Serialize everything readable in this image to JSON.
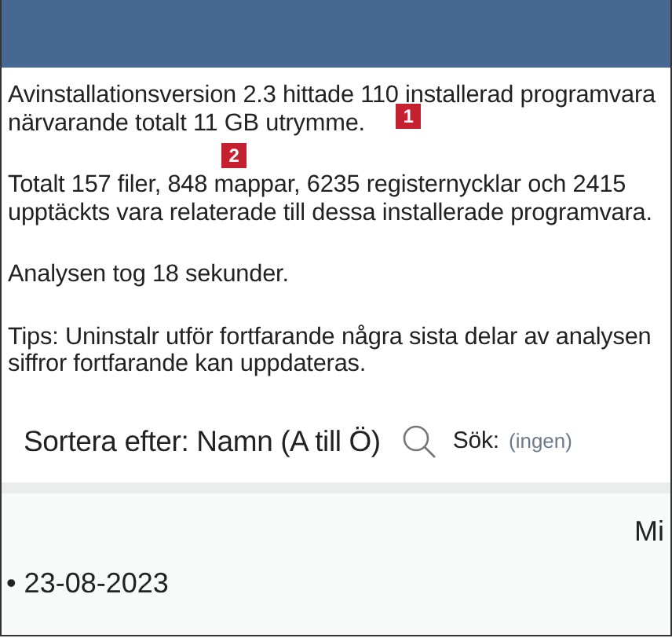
{
  "paragraphs": [
    {
      "lines": [
        "Avinstallationsversion 2.3 hittade 110 installerad programvara",
        "närvarande totalt 11 GB utrymme."
      ]
    },
    {
      "lines": [
        "Totalt 157 filer, 848 mappar, 6235 registernycklar och 2415",
        "upptäckts vara relaterade till dessa installerade programvara."
      ]
    },
    {
      "lines": [
        "Analysen tog 18 sekunder."
      ]
    },
    {
      "lines": [
        "Tips: Uninstalr utför fortfarande några sista delar av analysen",
        "siffror fortfarande kan uppdateras."
      ]
    }
  ],
  "markers": [
    "1",
    "2"
  ],
  "sort": {
    "label": "Sortera efter: Namn (A till Ö)"
  },
  "search": {
    "label": "Sök:",
    "placeholder": "(ingen)"
  },
  "list": {
    "column_1": "Mi",
    "date": "• 23-08-2023"
  }
}
